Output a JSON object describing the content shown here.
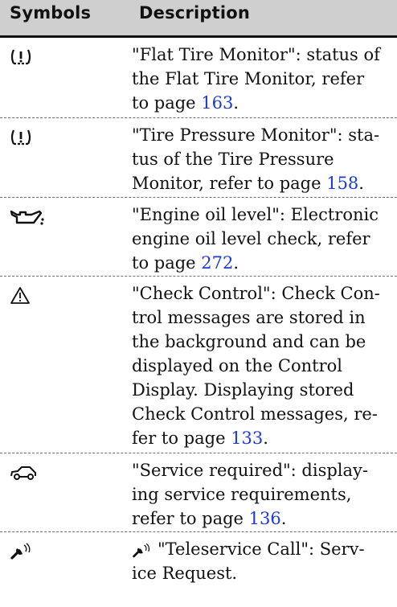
{
  "header": {
    "symbols": "Symbols",
    "description": "Description"
  },
  "rows": [
    {
      "icon": "tire-pressure-warning-icon",
      "lines": [
        "\"Flat Tire Monitor\": status of",
        "the Flat Tire Monitor, refer",
        "to page "
      ],
      "page": "163",
      "tail": "."
    },
    {
      "icon": "tire-pressure-warning-icon",
      "lines": [
        "\"Tire Pressure Monitor\": sta-",
        "tus of the Tire Pressure",
        "Monitor, refer to page "
      ],
      "page": "158",
      "tail": "."
    },
    {
      "icon": "oil-can-icon",
      "lines": [
        "\"Engine oil level\": Electronic",
        "engine oil level check, refer",
        "to page "
      ],
      "page": "272",
      "tail": "."
    },
    {
      "icon": "warning-triangle-icon",
      "lines": [
        "\"Check Control\": Check Con-",
        "trol messages are stored in",
        "the background and can be",
        "displayed on the Control",
        "Display. Displaying stored",
        "Check Control messages, re-",
        "fer to page "
      ],
      "page": "133",
      "tail": "."
    },
    {
      "icon": "car-service-icon",
      "lines": [
        "\"Service required\": display-",
        "ing service requirements,",
        "refer to page "
      ],
      "page": "136",
      "tail": "."
    },
    {
      "icon": "teleservice-wrench-icon",
      "lines": [
        "\"Teleservice Call\": Serv-",
        "ice Request."
      ]
    }
  ]
}
